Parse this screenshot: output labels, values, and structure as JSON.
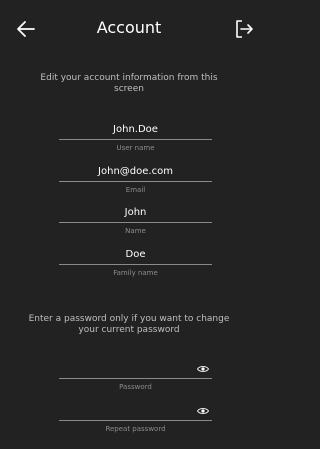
{
  "header": {
    "title": "Account",
    "back_icon": "arrow-left-icon",
    "logout_icon": "logout-icon"
  },
  "intro_text": "Edit your account information from this screen",
  "fields": [
    {
      "value": "John.Doe",
      "label": "User name"
    },
    {
      "value": "John@doe.com",
      "label": "Email"
    },
    {
      "value": "John",
      "label": "Name"
    },
    {
      "value": "Doe",
      "label": "Family name"
    }
  ],
  "password_note": "Enter a password only if you want to change your current password",
  "password_fields": [
    {
      "value": "",
      "label": "Password",
      "icon": "eye-icon"
    },
    {
      "value": "",
      "label": "Repeat password",
      "icon": "eye-icon"
    }
  ],
  "colors": {
    "background": "#222222",
    "text": "#ffffff",
    "muted": "#8c8c8c",
    "line": "#8a8a8a"
  }
}
